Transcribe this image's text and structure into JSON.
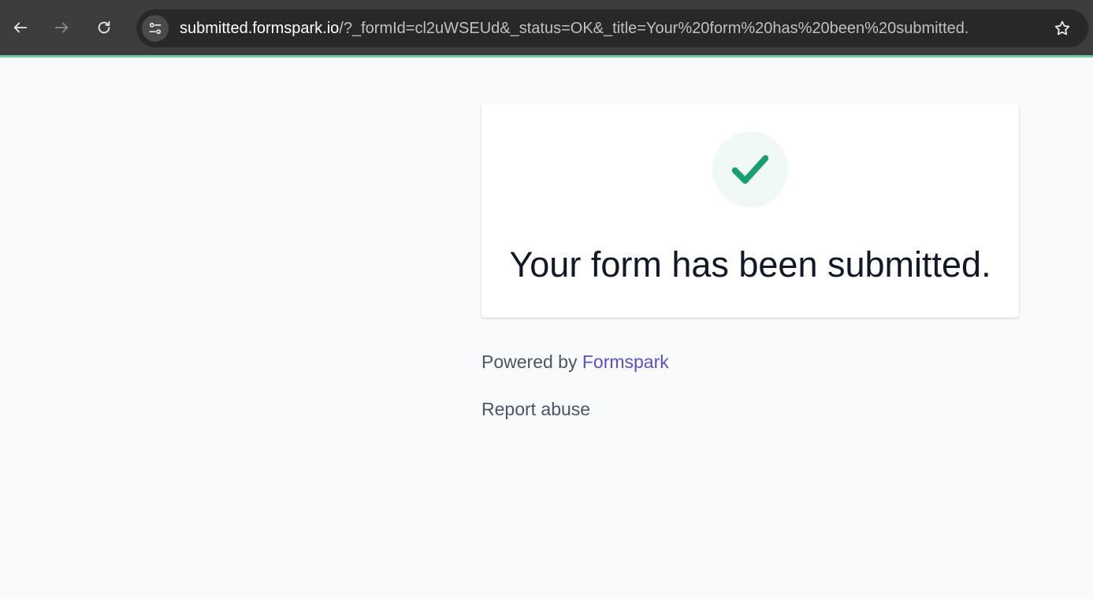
{
  "browser": {
    "url_host": "submitted.formspark.io",
    "url_rest": "/?_formId=cl2uWSEUd&_status=OK&_title=Your%20form%20has%20been%20submitted.",
    "icons": {
      "back": "arrow-left-icon",
      "forward": "arrow-right-icon",
      "reload": "reload-icon",
      "site_info": "tune-icon",
      "bookmark": "star-icon"
    }
  },
  "card": {
    "icon": "checkmark-icon",
    "title": "Your form has been submitted."
  },
  "footer": {
    "powered_prefix": "Powered by ",
    "powered_link": "Formspark",
    "report_link": "Report abuse"
  },
  "colors": {
    "accent_green": "#179f6e",
    "link_purple": "#5a4fcf",
    "toolbar_bg": "#3c3c3c",
    "page_bg": "#f9fafb"
  }
}
